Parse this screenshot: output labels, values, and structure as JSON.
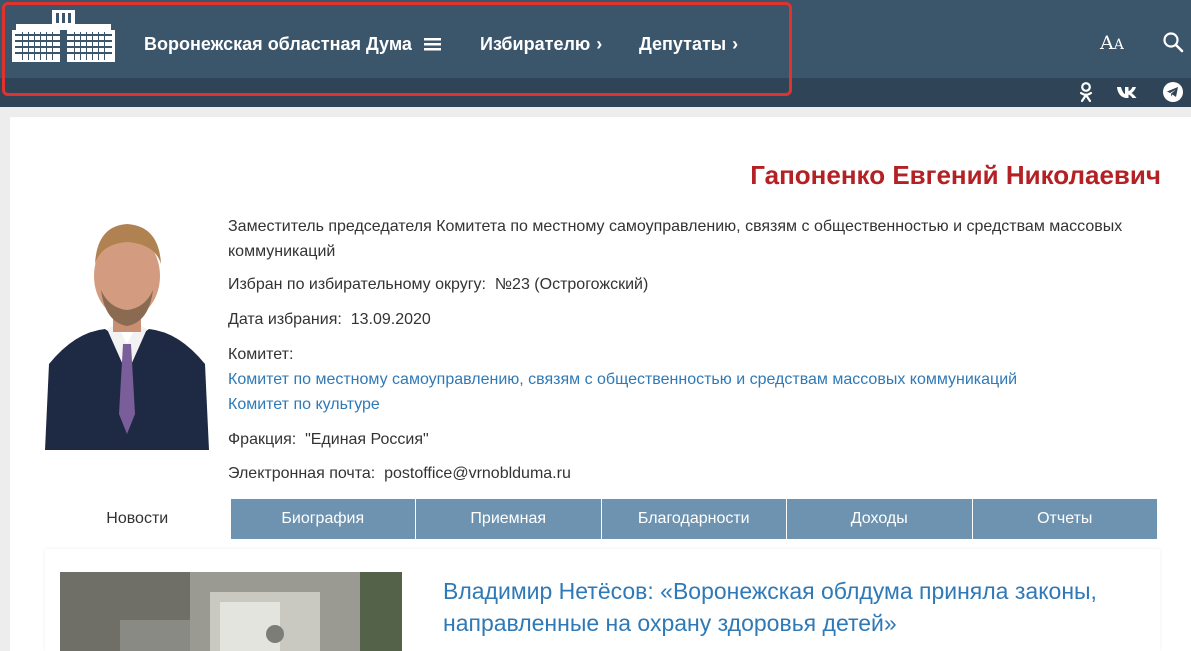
{
  "header": {
    "nav": [
      {
        "label": "Воронежская областная Дума",
        "suffix": "≡"
      },
      {
        "label": "Избирателю",
        "suffix": "›"
      },
      {
        "label": "Депутаты",
        "suffix": "›"
      }
    ],
    "font_toggle": {
      "big": "A",
      "small": "A"
    },
    "icons": [
      "building-logo",
      "search-icon",
      "odnoklassniki-icon",
      "vk-icon",
      "telegram-icon"
    ],
    "colors": {
      "header_bg": "#3b556b",
      "subbar_bg": "#2f4557",
      "highlight": "#e0332e"
    }
  },
  "deputy": {
    "name": "Гапоненко Евгений Николаевич",
    "position": "Заместитель председателя Комитета по местному самоуправлению, связям с общественностью и средствам массовых коммуникаций",
    "district_label": "Избран по избирательному округу:",
    "district_value": "№23 (Острогожский)",
    "date_label": "Дата избрания:",
    "date_value": "13.09.2020",
    "committee_label": "Комитет:",
    "committees": [
      "Комитет по местному самоуправлению, связям с общественностью и средствам массовых коммуникаций",
      "Комитет по культуре"
    ],
    "faction_label": "Фракция:",
    "faction_value": "\"Единая Россия\"",
    "email_label": "Электронная почта:",
    "email_value": "postoffice@vrnoblduma.ru",
    "name_color": "#b42125",
    "link_color": "#2f79b6"
  },
  "tabs": [
    {
      "label": "Новости",
      "active": true
    },
    {
      "label": "Биография",
      "active": false
    },
    {
      "label": "Приемная",
      "active": false
    },
    {
      "label": "Благодарности",
      "active": false
    },
    {
      "label": "Доходы",
      "active": false
    },
    {
      "label": "Отчеты",
      "active": false
    }
  ],
  "news": {
    "title": "Владимир Нетёсов: «Воронежская облдума приняла законы, направленные на охрану здоровья детей»"
  }
}
